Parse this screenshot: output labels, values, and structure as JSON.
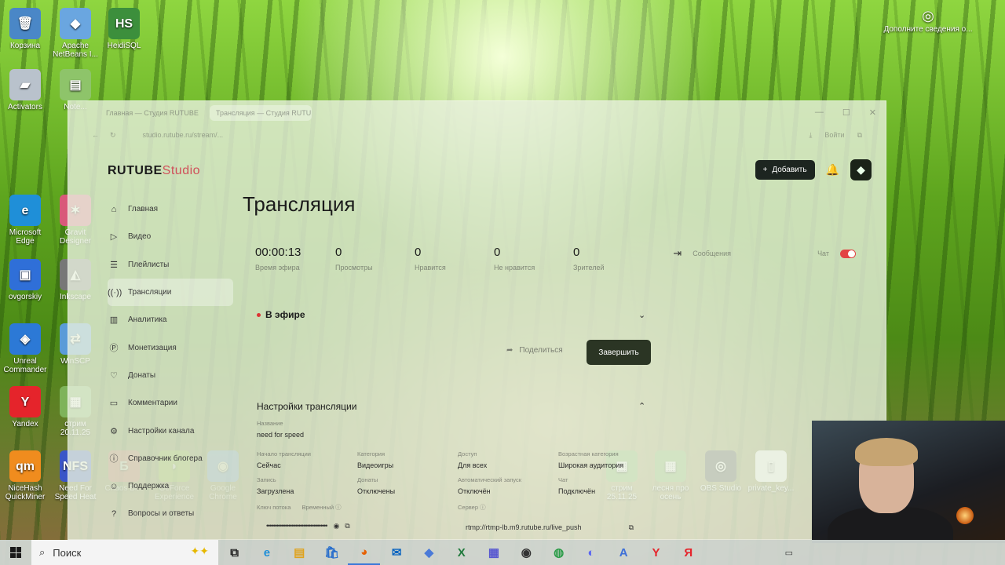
{
  "desktop": {
    "icons": [
      {
        "label": "Корзина",
        "glyph": "🗑",
        "color": "#4a87c7"
      },
      {
        "label": "Apache NetBeans I...",
        "glyph": "◆",
        "color": "#6aa6e0"
      },
      {
        "label": "HeidiSQL",
        "glyph": "HS",
        "color": "#3c8f3c"
      },
      {
        "label": "Activators",
        "glyph": "▰",
        "color": "#b9c2cc"
      },
      {
        "label": "Note...",
        "glyph": "▤",
        "color": "#8ec46a"
      },
      {
        "label": "Microsoft Edge",
        "glyph": "e",
        "color": "#1f8fd8"
      },
      {
        "label": "Gravit Designer",
        "glyph": "✶",
        "color": "#d9597a"
      },
      {
        "label": "ovgorskiy",
        "glyph": "▣",
        "color": "#2f6fd8"
      },
      {
        "label": "Inkscape",
        "glyph": "◭",
        "color": "#777"
      },
      {
        "label": "Unreal Commander",
        "glyph": "◈",
        "color": "#2c79d6"
      },
      {
        "label": "WinSCP",
        "glyph": "⇄",
        "color": "#5a9bd8"
      },
      {
        "label": "Yandex",
        "glyph": "Y",
        "color": "#e5242b"
      },
      {
        "label": "стрим 20.11.25",
        "glyph": "▦",
        "color": "#7eb35a"
      },
      {
        "label": "NiceHash QuickMiner",
        "glyph": "qm",
        "color": "#f08c1e"
      },
      {
        "label": "Need For Speed Heat",
        "glyph": "NFS",
        "color": "#3a55c8"
      },
      {
        "label": "Chaos Bi...",
        "glyph": "Б",
        "color": "#d04848"
      },
      {
        "label": "GeForce Experience",
        "glyph": "◗",
        "color": "#76b900"
      },
      {
        "label": "Google Chrome",
        "glyph": "◉",
        "color": "#4285f4"
      },
      {
        "label": "стрим 25.11.25",
        "glyph": "▦",
        "color": "#7eb35a"
      },
      {
        "label": "лесня про осень",
        "glyph": "▦",
        "color": "#7eb35a"
      },
      {
        "label": "OBS Studio",
        "glyph": "◎",
        "color": "#444"
      },
      {
        "label": "private_key...",
        "glyph": "▯",
        "color": "#f2f2f2"
      }
    ],
    "corner_notice": "Дополните сведения о..."
  },
  "browser": {
    "tabs": [
      "Главная — Студия RUTUBE",
      "Трансляция — Студия RUTUBE"
    ],
    "url": "studio.rutube.ru/stream/...",
    "account_label": "Войти"
  },
  "studio": {
    "logo_main": "RUTUBE",
    "logo_sub": "Studio",
    "add_button": "Добавить",
    "nav": [
      {
        "icon": "⌂",
        "label": "Главная"
      },
      {
        "icon": "▷",
        "label": "Видео"
      },
      {
        "icon": "☰",
        "label": "Плейлисты"
      },
      {
        "icon": "((·))",
        "label": "Трансляции"
      },
      {
        "icon": "▥",
        "label": "Аналитика"
      },
      {
        "icon": "Ⓟ",
        "label": "Монетизация"
      },
      {
        "icon": "♡",
        "label": "Донаты"
      },
      {
        "icon": "▭",
        "label": "Комментарии"
      },
      {
        "icon": "⚙",
        "label": "Настройки канала"
      },
      {
        "icon": "ⓘ",
        "label": "Справочник блогера"
      },
      {
        "icon": "☺",
        "label": "Поддержка"
      },
      {
        "icon": "?",
        "label": "Вопросы и ответы"
      }
    ],
    "page_title": "Трансляция",
    "stats": [
      {
        "value": "00:00:13",
        "label": "Время эфира"
      },
      {
        "value": "0",
        "label": "Просмотры"
      },
      {
        "value": "0",
        "label": "Нравится"
      },
      {
        "value": "0",
        "label": "Не нравится"
      },
      {
        "value": "0",
        "label": "Зрителей"
      }
    ],
    "messages_label": "Сообщения",
    "chat_label": "Чат",
    "live_label": "В эфире",
    "share_label": "Поделиться",
    "finish_label": "Завершить",
    "settings_title": "Настройки трансляции",
    "fields": {
      "name_label": "Название",
      "name_value": "need for speed",
      "start_label": "Начало трансляции",
      "start_value": "Сейчас",
      "category_label": "Категория",
      "category_value": "Видеоигры",
      "access_label": "Доступ",
      "access_value": "Для всех",
      "age_label": "Возрастная категория",
      "age_value": "Широкая аудитория",
      "record_label": "Запись",
      "record_value": "Загрузлена",
      "donate_label": "Донаты",
      "donate_value": "Отключены",
      "autostart_label": "Автоматический запуск",
      "autostart_value": "Отключён",
      "chat_label": "Чат",
      "chat_value": "Подключён",
      "key_label": "Ключ потока",
      "key_badge": "Временный",
      "key_value": "••••••••••••••••••••••••••••••••••••",
      "server_label": "Сервер",
      "server_value": "rtmp://rtmp-lb.m9.rutube.ru/live_push"
    }
  },
  "taskbar": {
    "search_placeholder": "Поиск",
    "apps": [
      "task-view",
      "edge",
      "explorer",
      "store",
      "firefox",
      "outlook",
      "3d",
      "excel",
      "tool",
      "obs",
      "chrome",
      "discord",
      "app",
      "yandex",
      "yandex-music"
    ],
    "app_glyphs": [
      "⧉",
      "e",
      "▤",
      "🛍",
      "◕",
      "✉",
      "◆",
      "X",
      "▦",
      "◉",
      "◍",
      "◐",
      "A",
      "Y",
      "Я"
    ],
    "app_colors": [
      "#222",
      "#1f8fd8",
      "#e0a21c",
      "#2a6fcc",
      "#e66000",
      "#0a64c0",
      "#4a7ad8",
      "#1f7a3c",
      "#5858d0",
      "#333",
      "#2b9c48",
      "#5865f2",
      "#3d6fd8",
      "#e5242b",
      "#e5242b"
    ]
  }
}
